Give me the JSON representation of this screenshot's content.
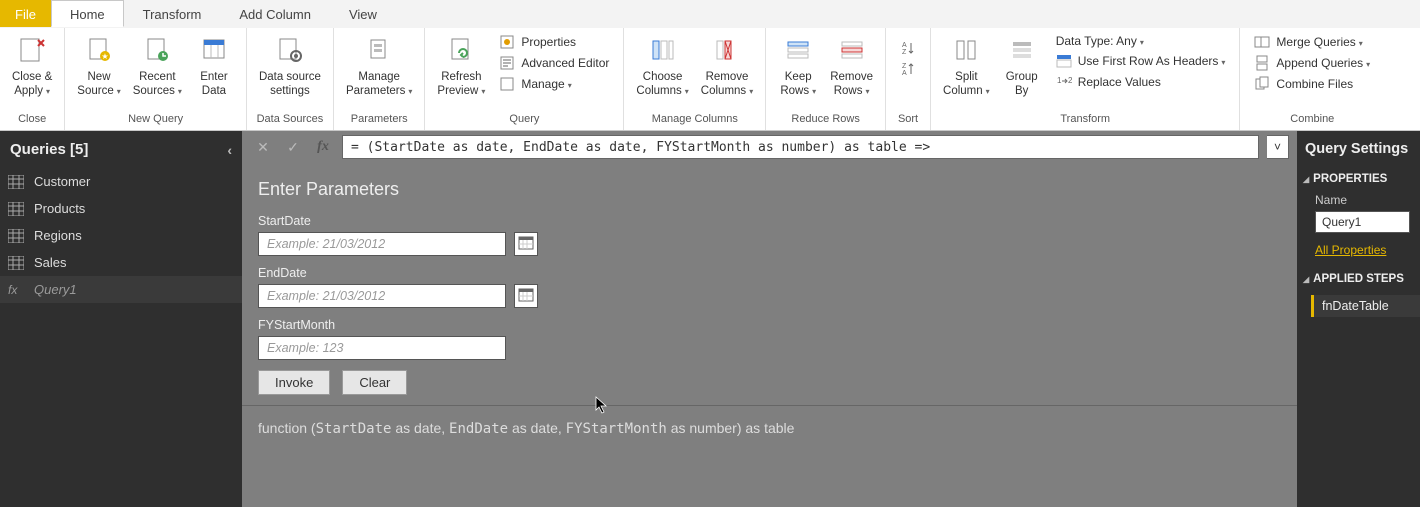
{
  "tabs": {
    "file": "File",
    "home": "Home",
    "transform": "Transform",
    "add_column": "Add Column",
    "view": "View"
  },
  "ribbon": {
    "close_apply": "Close &\nApply",
    "new_source": "New\nSource",
    "recent_sources": "Recent\nSources",
    "enter_data": "Enter\nData",
    "data_source_settings": "Data source\nsettings",
    "manage_parameters": "Manage\nParameters",
    "refresh_preview": "Refresh\nPreview",
    "properties": "Properties",
    "advanced_editor": "Advanced Editor",
    "manage": "Manage",
    "choose_columns": "Choose\nColumns",
    "remove_columns": "Remove\nColumns",
    "keep_rows": "Keep\nRows",
    "remove_rows": "Remove\nRows",
    "split_column": "Split\nColumn",
    "group_by": "Group\nBy",
    "data_type": "Data Type: Any",
    "first_row_headers": "Use First Row As Headers",
    "replace_values": "Replace Values",
    "merge_queries": "Merge Queries",
    "append_queries": "Append Queries",
    "combine_files": "Combine Files",
    "g_close": "Close",
    "g_new_query": "New Query",
    "g_data_sources": "Data Sources",
    "g_parameters": "Parameters",
    "g_query": "Query",
    "g_manage_columns": "Manage Columns",
    "g_reduce_rows": "Reduce Rows",
    "g_sort": "Sort",
    "g_transform": "Transform",
    "g_combine": "Combine"
  },
  "left": {
    "title": "Queries [5]",
    "items": [
      "Customer",
      "Products",
      "Regions",
      "Sales",
      "Query1"
    ]
  },
  "formula": "= (StartDate as date, EndDate as date, FYStartMonth as number) as table =>",
  "params": {
    "heading": "Enter Parameters",
    "start_label": "StartDate",
    "end_label": "EndDate",
    "fy_label": "FYStartMonth",
    "date_placeholder": "Example: 21/03/2012",
    "num_placeholder": "Example: 123",
    "invoke": "Invoke",
    "clear": "Clear"
  },
  "signature": {
    "pre": "function (",
    "p1": "StartDate",
    "as_date1": " as date, ",
    "p2": "EndDate",
    "as_date2": " as date, ",
    "p3": "FYStartMonth",
    "tail": " as number) as table"
  },
  "right": {
    "title": "Query Settings",
    "properties": "PROPERTIES",
    "name": "Name",
    "name_value": "Query1",
    "all_properties": "All Properties",
    "applied_steps": "APPLIED STEPS",
    "step1": "fnDateTable"
  }
}
